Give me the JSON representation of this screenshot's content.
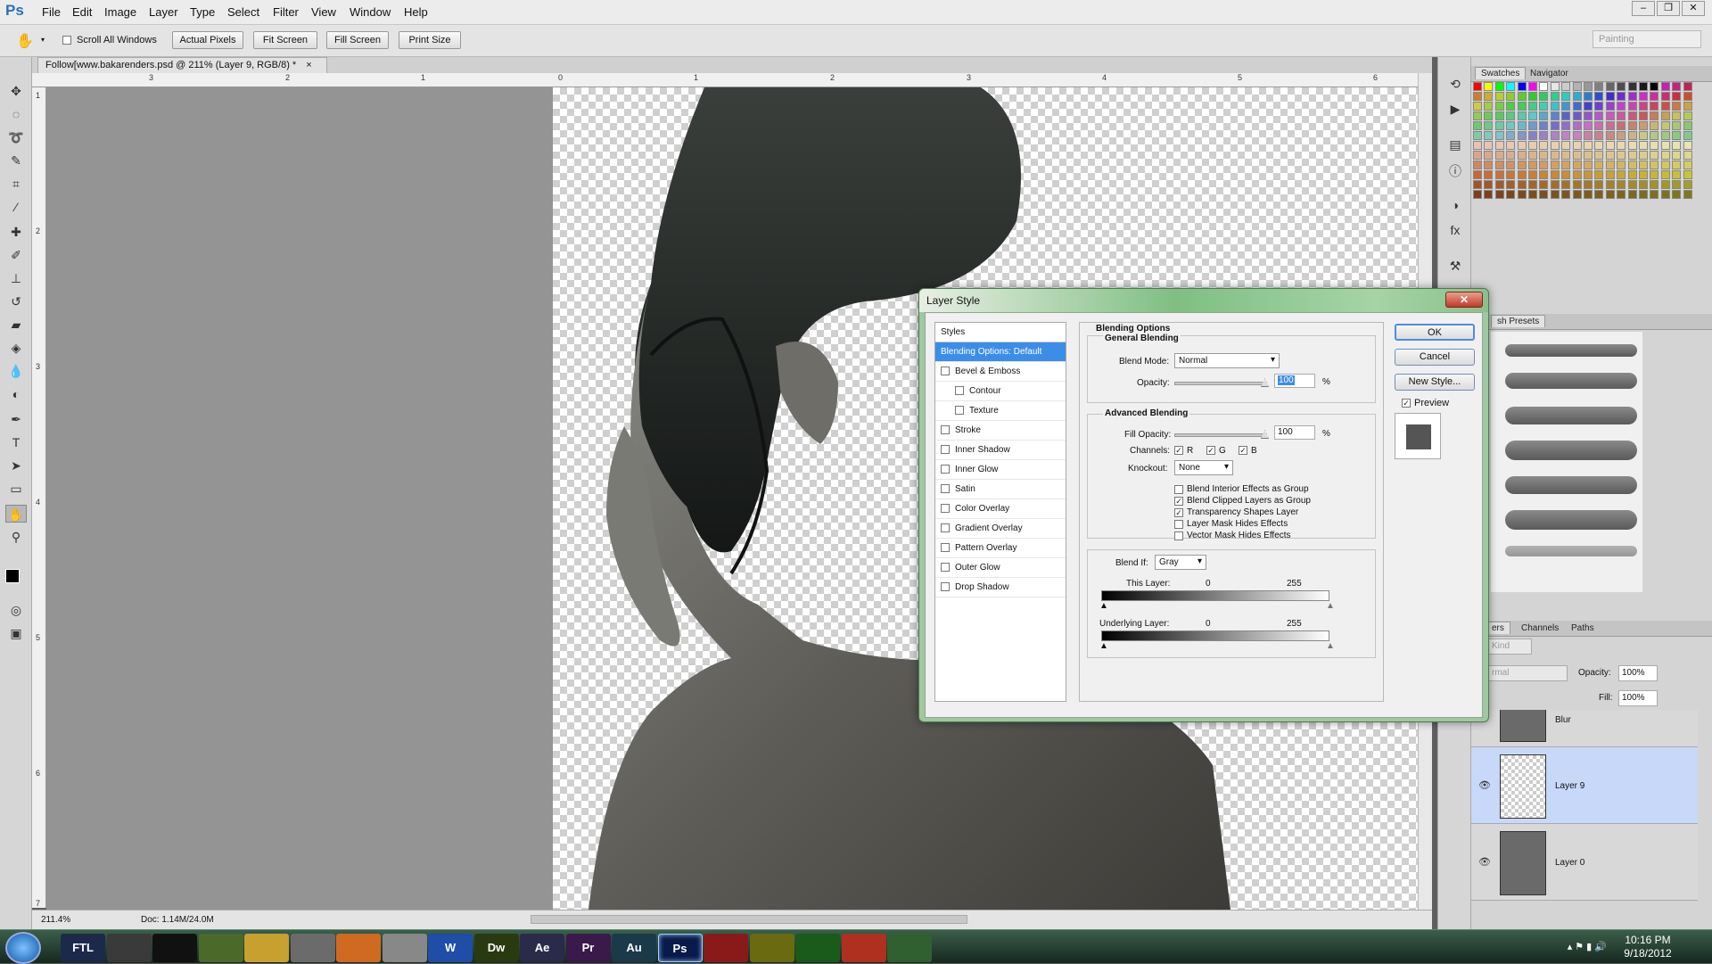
{
  "app": {
    "logo": "Ps",
    "menu": [
      "File",
      "Edit",
      "Image",
      "Layer",
      "Type",
      "Select",
      "Filter",
      "View",
      "Window",
      "Help"
    ]
  },
  "window_controls": {
    "minimize": "–",
    "restore": "❐",
    "close": "✕"
  },
  "options_bar": {
    "scroll_all_windows": "Scroll All Windows",
    "actual_pixels": "Actual Pixels",
    "fit_screen": "Fit Screen",
    "fill_screen": "Fill Screen",
    "print_size": "Print Size",
    "workspace": "Painting"
  },
  "document": {
    "tab_title": "Follow[www.bakarenders.psd @ 211% (Layer 9, RGB/8) *",
    "tab_close": "×",
    "ruler_top": [
      "3",
      "2",
      "1",
      "0",
      "1",
      "2",
      "3",
      "4",
      "5",
      "6"
    ],
    "ruler_left": [
      "1",
      "2",
      "3",
      "4",
      "5",
      "6",
      "7"
    ]
  },
  "status": {
    "zoom": "211.4%",
    "doc_size": "Doc: 1.14M/24.0M"
  },
  "swatches_panel": {
    "tabs": [
      "Swatches",
      "Navigator"
    ]
  },
  "brush_panel": {
    "tab": "sh Presets"
  },
  "layers_panel": {
    "tabs": [
      "ers",
      "Channels",
      "Paths"
    ],
    "kind": "Kind",
    "blend": "rmal",
    "opacity_label": "Opacity:",
    "opacity_value": "100%",
    "fill_label": "Fill:",
    "fill_value": "100%",
    "layers": [
      {
        "name": "Blur",
        "visible": false
      },
      {
        "name": "Layer 9",
        "visible": true,
        "selected": true
      },
      {
        "name": "Layer 0",
        "visible": true
      }
    ]
  },
  "dialog": {
    "title": "Layer Style",
    "close": "✕",
    "styles_header": "Styles",
    "styles": [
      {
        "label": "Blending Options: Default",
        "selected": true,
        "checkbox": false,
        "indent": false
      },
      {
        "label": "Bevel & Emboss",
        "checkbox": true,
        "checked": false,
        "indent": false
      },
      {
        "label": "Contour",
        "checkbox": true,
        "checked": false,
        "indent": true
      },
      {
        "label": "Texture",
        "checkbox": true,
        "checked": false,
        "indent": true
      },
      {
        "label": "Stroke",
        "checkbox": true,
        "checked": false,
        "indent": false
      },
      {
        "label": "Inner Shadow",
        "checkbox": true,
        "checked": false,
        "indent": false
      },
      {
        "label": "Inner Glow",
        "checkbox": true,
        "checked": false,
        "indent": false
      },
      {
        "label": "Satin",
        "checkbox": true,
        "checked": false,
        "indent": false
      },
      {
        "label": "Color Overlay",
        "checkbox": true,
        "checked": false,
        "indent": false
      },
      {
        "label": "Gradient Overlay",
        "checkbox": true,
        "checked": false,
        "indent": false
      },
      {
        "label": "Pattern Overlay",
        "checkbox": true,
        "checked": false,
        "indent": false
      },
      {
        "label": "Outer Glow",
        "checkbox": true,
        "checked": false,
        "indent": false
      },
      {
        "label": "Drop Shadow",
        "checkbox": true,
        "checked": false,
        "indent": false
      }
    ],
    "blending_options": "Blending Options",
    "general_blending": "General Blending",
    "blend_mode_label": "Blend Mode:",
    "blend_mode": "Normal",
    "opacity_label": "Opacity:",
    "opacity": "100",
    "percent": "%",
    "advanced_blending": "Advanced Blending",
    "fill_opacity_label": "Fill Opacity:",
    "fill_opacity": "100",
    "channels_label": "Channels:",
    "channel_r": "R",
    "channel_g": "G",
    "channel_b": "B",
    "knockout_label": "Knockout:",
    "knockout": "None",
    "options": [
      {
        "label": "Blend Interior Effects as Group",
        "checked": false
      },
      {
        "label": "Blend Clipped Layers as Group",
        "checked": true
      },
      {
        "label": "Transparency Shapes Layer",
        "checked": true
      },
      {
        "label": "Layer Mask Hides Effects",
        "checked": false
      },
      {
        "label": "Vector Mask Hides Effects",
        "checked": false
      }
    ],
    "blend_if_label": "Blend If:",
    "blend_if": "Gray",
    "this_layer_label": "This Layer:",
    "this_layer_min": "0",
    "this_layer_max": "255",
    "underlying_label": "Underlying Layer:",
    "underlying_min": "0",
    "underlying_max": "255",
    "ok": "OK",
    "cancel": "Cancel",
    "new_style": "New Style...",
    "preview": "Preview"
  },
  "taskbar": {
    "apps": [
      "FTL",
      "",
      "",
      "",
      "",
      "",
      "",
      "",
      "W",
      "Dw",
      "Ae",
      "Pr",
      "Au",
      "Ps",
      "",
      "",
      "",
      "",
      ""
    ],
    "time": "10:16 PM",
    "date": "9/18/2012"
  },
  "colors": {
    "accent": "#3b8de8",
    "dialog_frame": "#9fc7a0",
    "layer_selected": "#c8d8f8"
  }
}
